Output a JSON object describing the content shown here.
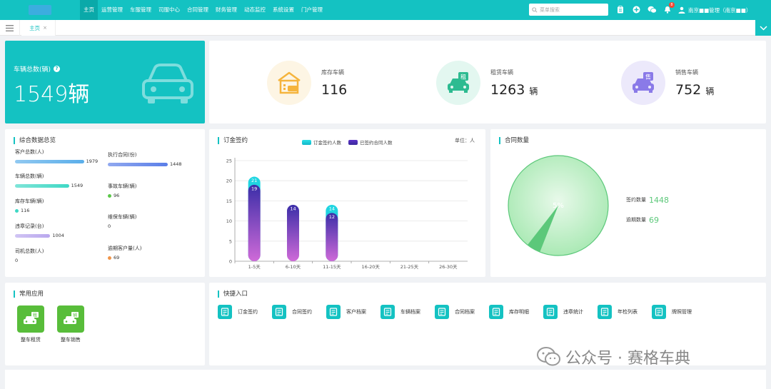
{
  "header": {
    "nav": [
      "主页",
      "运营管理",
      "车服管理",
      "司服中心",
      "合同管理",
      "财务管理",
      "动态监控",
      "系统设置",
      "门户管理"
    ],
    "active_index": 0,
    "search_placeholder": "菜单搜索",
    "notification_count": "8",
    "user_name": "南京■■管理（南京■■）"
  },
  "tabs": {
    "home_label": "主页",
    "close": "×"
  },
  "total": {
    "label": "车辆总数(辆)",
    "value": "1549辆"
  },
  "stats": [
    {
      "label": "库存车辆",
      "value": "116",
      "unit": "",
      "icon": "garage-icon",
      "bg": "#fdf5e4",
      "color": "#f5b43c"
    },
    {
      "label": "租赁车辆",
      "value": "1263",
      "unit": "辆",
      "icon": "rent-car-icon",
      "bg": "#e3f7f0",
      "color": "#2dbb91",
      "badge": "租"
    },
    {
      "label": "销售车辆",
      "value": "752",
      "unit": "辆",
      "icon": "sale-car-icon",
      "bg": "#ece9fb",
      "color": "#8a7ae8",
      "badge": "售"
    }
  ],
  "overview": {
    "title": "综合数据总览",
    "left": [
      {
        "label": "客户总数(人)",
        "value": "1979",
        "fill": 0.92,
        "color": "#5aaeea",
        "kind": "bar"
      },
      {
        "label": "车辆总数(辆)",
        "value": "1549",
        "fill": 0.72,
        "color": "#3fd8c5",
        "kind": "bar"
      },
      {
        "label": "库存车辆(辆)",
        "value": "116",
        "color": "#3fd8c5",
        "kind": "dot"
      },
      {
        "label": "违章记录(台)",
        "value": "1004",
        "fill": 0.47,
        "color": "#b9a7ee",
        "kind": "bar"
      },
      {
        "label": "司机总数(人)",
        "value": "0",
        "kind": "none"
      }
    ],
    "right": [
      {
        "label": "执行合同(份)",
        "value": "1448",
        "fill": 0.8,
        "color": "#5a7ee8",
        "kind": "bar"
      },
      {
        "label": "事故车辆(辆)",
        "value": "96",
        "color": "#5cc84a",
        "kind": "dot"
      },
      {
        "label": "维保车辆(辆)",
        "value": "0",
        "kind": "none"
      },
      {
        "label": "逾期客户量(人)",
        "value": "69",
        "color": "#f0954a",
        "kind": "dot"
      }
    ]
  },
  "orders": {
    "title": "订金签约",
    "unit": "单位：人",
    "legend": [
      "订金签约人数",
      "已签约合同人数"
    ]
  },
  "chart_data": {
    "type": "bar",
    "categories": [
      "1-5天",
      "6-10天",
      "11-15天",
      "16-20天",
      "21-25天",
      "26-30天"
    ],
    "series": [
      {
        "name": "订金签约人数",
        "values": [
          21,
          null,
          14,
          null,
          null,
          null
        ]
      },
      {
        "name": "已签约合同人数",
        "values": [
          19,
          14,
          12,
          null,
          null,
          null
        ]
      }
    ],
    "yticks": [
      0,
      5,
      10,
      15,
      20,
      25
    ],
    "ylim": [
      0,
      25
    ]
  },
  "contracts": {
    "title": "合同数量",
    "pie_label": "5%",
    "items": [
      {
        "label": "签约数量",
        "value": "1448"
      },
      {
        "label": "逾期数量",
        "value": "69"
      }
    ],
    "pie_values": [
      1448,
      69
    ]
  },
  "apps": {
    "title": "常用应用",
    "items": [
      {
        "label": "整车租赁",
        "badge": "租"
      },
      {
        "label": "整车销售",
        "badge": "销"
      }
    ]
  },
  "quick": {
    "title": "快捷入口",
    "items": [
      "订金签约",
      "合同签约",
      "客户档案",
      "车辆档案",
      "合同档案",
      "库存明细",
      "违章统计",
      "年检列表",
      "牌照管理"
    ]
  },
  "watermark": "公众号 · 赛格车典"
}
